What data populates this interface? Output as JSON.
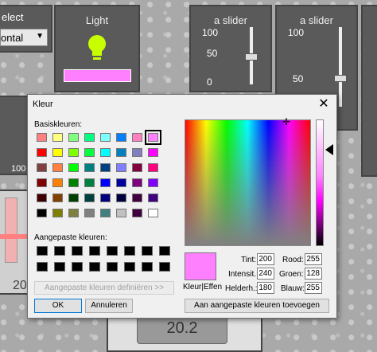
{
  "bg_panels": {
    "left_top": {
      "label": "elect",
      "dropdown_value": "ontal"
    },
    "light": {
      "title": "Light",
      "bulb_color": "#c8ff00",
      "bar_color": "#ff80ff"
    },
    "slider1": {
      "title": "a slider",
      "ticks": [
        "100",
        "50",
        "0"
      ],
      "value_fraction": 0.5
    },
    "slider2": {
      "title": "a slider",
      "ticks": [
        "100",
        "50"
      ],
      "value_fraction": 0.5
    },
    "left_num": "100",
    "left_bottom_value": "20",
    "bottom_value": "20.2"
  },
  "dialog": {
    "title": "Kleur",
    "basic_label": "Basiskleuren:",
    "basic_colors": [
      [
        "#ff8080",
        "#ffff80",
        "#80ff80",
        "#00ff80",
        "#80ffff",
        "#0080ff",
        "#ff80c0",
        "#ff80ff"
      ],
      [
        "#ff0000",
        "#ffff00",
        "#80ff00",
        "#00ff40",
        "#00ffff",
        "#0080c0",
        "#8080c0",
        "#ff00ff"
      ],
      [
        "#804040",
        "#ff8040",
        "#00ff00",
        "#008080",
        "#004080",
        "#8080ff",
        "#800040",
        "#ff0080"
      ],
      [
        "#800000",
        "#ff8000",
        "#008000",
        "#008040",
        "#0000ff",
        "#0000a0",
        "#800080",
        "#8000ff"
      ],
      [
        "#400000",
        "#804000",
        "#004000",
        "#004040",
        "#000080",
        "#000040",
        "#400040",
        "#400080"
      ],
      [
        "#000000",
        "#808000",
        "#808040",
        "#808080",
        "#408080",
        "#c0c0c0",
        "#400040",
        "#ffffff"
      ]
    ],
    "custom_label": "Aangepaste kleuren:",
    "define_button": "Aangepaste kleuren definiëren >>",
    "ok_button": "OK",
    "cancel_button": "Annuleren",
    "preview_label": "Kleur|Effen",
    "preview_color": "#ff80ff",
    "hue_label": "Tint:",
    "hue": "200",
    "sat_label": "Intensit.:",
    "sat": "240",
    "lum_label": "Helderh.:",
    "lum": "180",
    "red_label": "Rood:",
    "red": "255",
    "green_label": "Groen:",
    "green": "128",
    "blue_label": "Blauw:",
    "blue": "255",
    "add_button": "Aan aangepaste kleuren toevoegen"
  }
}
